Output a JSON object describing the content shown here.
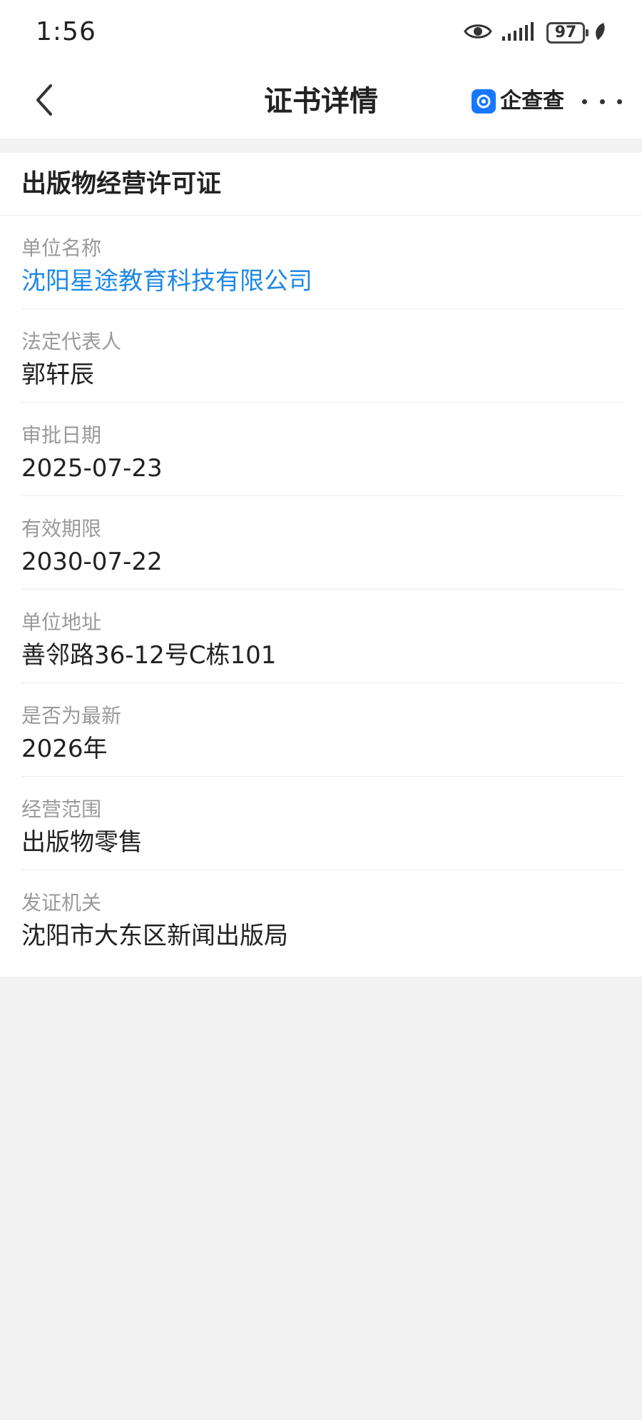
{
  "status_bar": {
    "time": "1:56",
    "battery": "97",
    "icons": [
      "eye-icon",
      "signal-icon",
      "battery-icon",
      "leaf-icon"
    ]
  },
  "nav": {
    "title": "证书详情",
    "brand_name": "企查查",
    "icons": [
      "chevron-left-icon",
      "more-icon"
    ]
  },
  "certificate": {
    "title": "出版物经营许可证",
    "fields": [
      {
        "label": "单位名称",
        "value": "沈阳星途教育科技有限公司"
      },
      {
        "label": "法定代表人",
        "value": "郭轩辰"
      },
      {
        "label": "审批日期",
        "value": "2025-07-23"
      },
      {
        "label": "有效期限",
        "value": "2030-07-22"
      },
      {
        "label": "单位地址",
        "value": "善邻路36-12号C栋101"
      },
      {
        "label": "是否为最新",
        "value": "2026年"
      },
      {
        "label": "经营范围",
        "value": "出版物零售"
      },
      {
        "label": "发证机关",
        "value": "沈阳市大东区新闻出版局"
      }
    ]
  },
  "colors": {
    "link": "#1e88e5",
    "label": "#9a9a9a",
    "text": "#222222",
    "background": "#f2f2f2",
    "brand": "#1677ff"
  }
}
